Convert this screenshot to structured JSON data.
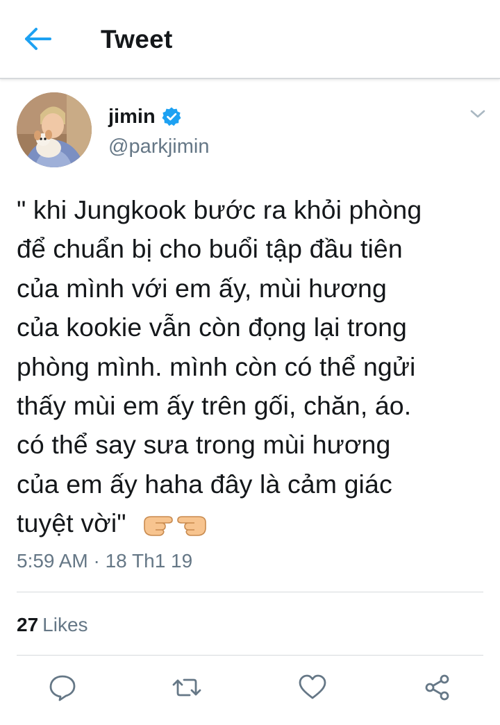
{
  "header": {
    "title": "Tweet",
    "back_icon": "arrow-left-icon"
  },
  "author": {
    "display_name": "jimin",
    "handle": "@parkjimin",
    "verified": true
  },
  "tweet": {
    "lines": [
      "\" khi Jungkook bước ra khỏi phòng",
      "để chuẩn bị cho buổi tập đầu tiên",
      "của mình với em ấy, mùi hương",
      "của kookie vẫn còn đọng lại trong",
      "phòng mình. mình còn có thể ngửi",
      "thấy mùi em ấy trên gối, chăn, áo.",
      "có thể say sưa trong mùi hương",
      "của em ấy haha đây là cảm giác",
      "tuyệt vời\""
    ],
    "emoji": "pointing-hands-emoji",
    "timestamp": "5:59 AM · 18 Th1 19"
  },
  "stats": {
    "likes_count": "27",
    "likes_label": "Likes"
  },
  "actions": [
    "reply-icon",
    "retweet-icon",
    "like-icon",
    "share-icon"
  ],
  "colors": {
    "accent": "#1da1f2",
    "text": "#14171a",
    "secondary": "#657786",
    "divider": "#d6d9dc"
  }
}
